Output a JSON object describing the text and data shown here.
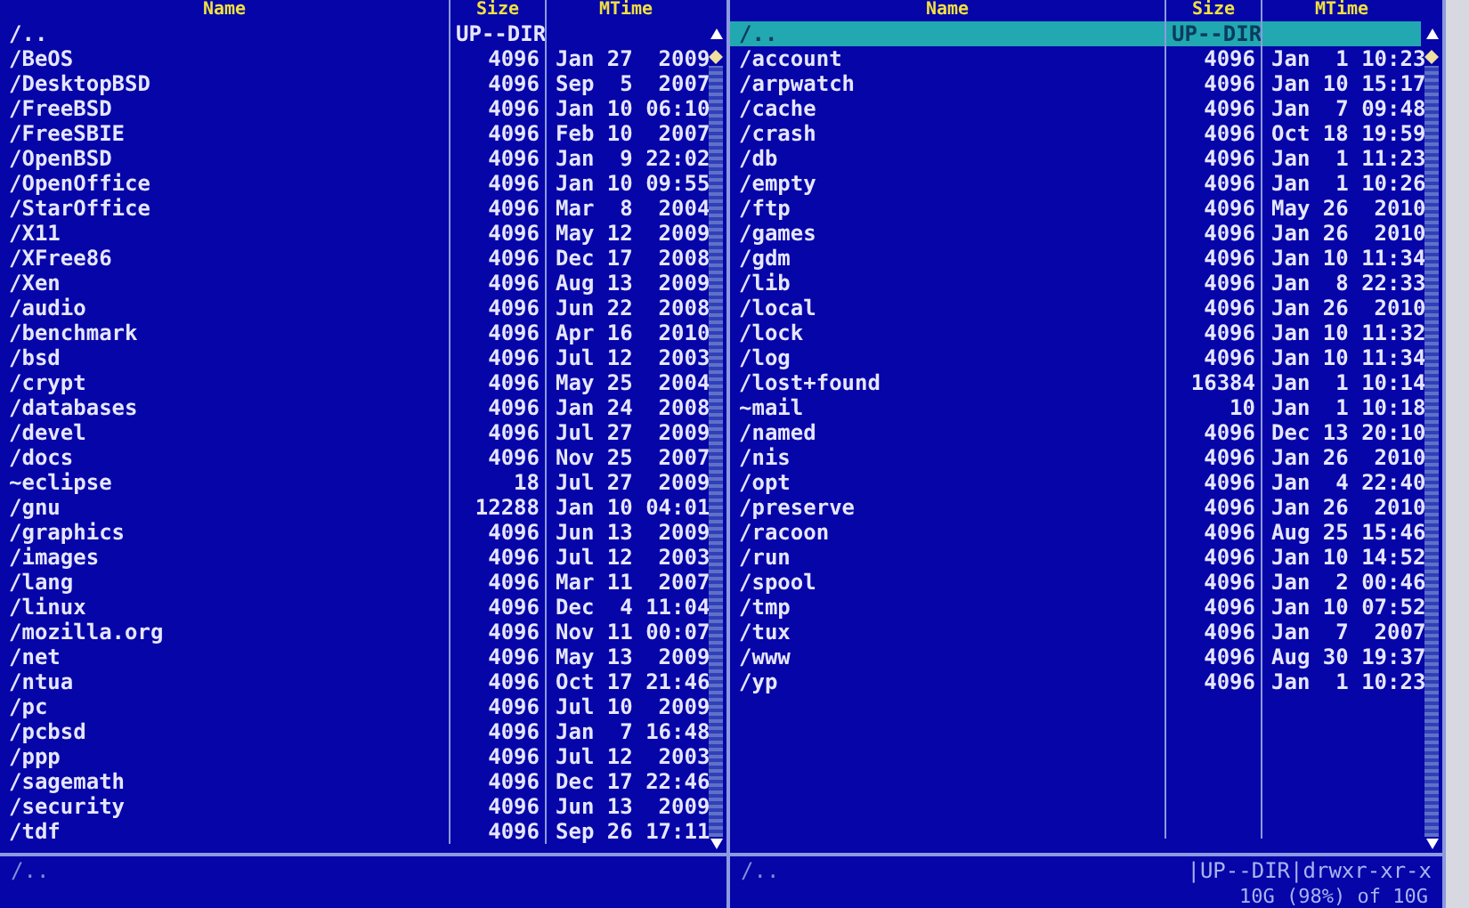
{
  "panels": [
    {
      "columns": [
        "Name",
        "Size",
        "MTime"
      ],
      "rows": [
        {
          "name": "/..",
          "size": "UP--DIR",
          "selected": false
        },
        {
          "name": "/BeOS",
          "size": "4096",
          "mtime": "Jan 27  2009",
          "selected": false
        },
        {
          "name": "/DesktopBSD",
          "size": "4096",
          "mtime": "Sep  5  2007",
          "selected": false
        },
        {
          "name": "/FreeBSD",
          "size": "4096",
          "mtime": "Jan 10 06:10",
          "selected": false
        },
        {
          "name": "/FreeSBIE",
          "size": "4096",
          "mtime": "Feb 10  2007",
          "selected": false
        },
        {
          "name": "/OpenBSD",
          "size": "4096",
          "mtime": "Jan  9 22:02",
          "selected": false
        },
        {
          "name": "/OpenOffice",
          "size": "4096",
          "mtime": "Jan 10 09:55",
          "selected": false
        },
        {
          "name": "/StarOffice",
          "size": "4096",
          "mtime": "Mar  8  2004",
          "selected": false
        },
        {
          "name": "/X11",
          "size": "4096",
          "mtime": "May 12  2009",
          "selected": false
        },
        {
          "name": "/XFree86",
          "size": "4096",
          "mtime": "Dec 17  2008",
          "selected": false
        },
        {
          "name": "/Xen",
          "size": "4096",
          "mtime": "Aug 13  2009",
          "selected": false
        },
        {
          "name": "/audio",
          "size": "4096",
          "mtime": "Jun 22  2008",
          "selected": false
        },
        {
          "name": "/benchmark",
          "size": "4096",
          "mtime": "Apr 16  2010",
          "selected": false
        },
        {
          "name": "/bsd",
          "size": "4096",
          "mtime": "Jul 12  2003",
          "selected": false
        },
        {
          "name": "/crypt",
          "size": "4096",
          "mtime": "May 25  2004",
          "selected": false
        },
        {
          "name": "/databases",
          "size": "4096",
          "mtime": "Jan 24  2008",
          "selected": false
        },
        {
          "name": "/devel",
          "size": "4096",
          "mtime": "Jul 27  2009",
          "selected": false
        },
        {
          "name": "/docs",
          "size": "4096",
          "mtime": "Nov 25  2007",
          "selected": false
        },
        {
          "name": "~eclipse",
          "size": "18",
          "mtime": "Jul 27  2009",
          "selected": false
        },
        {
          "name": "/gnu",
          "size": "12288",
          "mtime": "Jan 10 04:01",
          "selected": false
        },
        {
          "name": "/graphics",
          "size": "4096",
          "mtime": "Jun 13  2009",
          "selected": false
        },
        {
          "name": "/images",
          "size": "4096",
          "mtime": "Jul 12  2003",
          "selected": false
        },
        {
          "name": "/lang",
          "size": "4096",
          "mtime": "Mar 11  2007",
          "selected": false
        },
        {
          "name": "/linux",
          "size": "4096",
          "mtime": "Dec  4 11:04",
          "selected": false
        },
        {
          "name": "/mozilla.org",
          "size": "4096",
          "mtime": "Nov 11 00:07",
          "selected": false
        },
        {
          "name": "/net",
          "size": "4096",
          "mtime": "May 13  2009",
          "selected": false
        },
        {
          "name": "/ntua",
          "size": "4096",
          "mtime": "Oct 17 21:46",
          "selected": false
        },
        {
          "name": "/pc",
          "size": "4096",
          "mtime": "Jul 10  2009",
          "selected": false
        },
        {
          "name": "/pcbsd",
          "size": "4096",
          "mtime": "Jan  7 16:48",
          "selected": false
        },
        {
          "name": "/ppp",
          "size": "4096",
          "mtime": "Jul 12  2003",
          "selected": false
        },
        {
          "name": "/sagemath",
          "size": "4096",
          "mtime": "Dec 17 22:46",
          "selected": false
        },
        {
          "name": "/security",
          "size": "4096",
          "mtime": "Jun 13  2009",
          "selected": false
        },
        {
          "name": "/tdf",
          "size": "4096",
          "mtime": "Sep 26 17:11",
          "selected": false
        }
      ],
      "status": {
        "path": "/.."
      }
    },
    {
      "columns": [
        "Name",
        "Size",
        "MTime"
      ],
      "rows": [
        {
          "name": "/..",
          "size": "UP--DIR",
          "selected": true
        },
        {
          "name": "/account",
          "size": "4096",
          "mtime": "Jan  1 10:23",
          "selected": false
        },
        {
          "name": "/arpwatch",
          "size": "4096",
          "mtime": "Jan 10 15:17",
          "selected": false
        },
        {
          "name": "/cache",
          "size": "4096",
          "mtime": "Jan  7 09:48",
          "selected": false
        },
        {
          "name": "/crash",
          "size": "4096",
          "mtime": "Oct 18 19:59",
          "selected": false
        },
        {
          "name": "/db",
          "size": "4096",
          "mtime": "Jan  1 11:23",
          "selected": false
        },
        {
          "name": "/empty",
          "size": "4096",
          "mtime": "Jan  1 10:26",
          "selected": false
        },
        {
          "name": "/ftp",
          "size": "4096",
          "mtime": "May 26  2010",
          "selected": false
        },
        {
          "name": "/games",
          "size": "4096",
          "mtime": "Jan 26  2010",
          "selected": false
        },
        {
          "name": "/gdm",
          "size": "4096",
          "mtime": "Jan 10 11:34",
          "selected": false
        },
        {
          "name": "/lib",
          "size": "4096",
          "mtime": "Jan  8 22:33",
          "selected": false
        },
        {
          "name": "/local",
          "size": "4096",
          "mtime": "Jan 26  2010",
          "selected": false
        },
        {
          "name": "/lock",
          "size": "4096",
          "mtime": "Jan 10 11:32",
          "selected": false
        },
        {
          "name": "/log",
          "size": "4096",
          "mtime": "Jan 10 11:34",
          "selected": false
        },
        {
          "name": "/lost+found",
          "size": "16384",
          "mtime": "Jan  1 10:14",
          "selected": false
        },
        {
          "name": "~mail",
          "size": "10",
          "mtime": "Jan  1 10:18",
          "selected": false
        },
        {
          "name": "/named",
          "size": "4096",
          "mtime": "Dec 13 20:10",
          "selected": false
        },
        {
          "name": "/nis",
          "size": "4096",
          "mtime": "Jan 26  2010",
          "selected": false
        },
        {
          "name": "/opt",
          "size": "4096",
          "mtime": "Jan  4 22:40",
          "selected": false
        },
        {
          "name": "/preserve",
          "size": "4096",
          "mtime": "Jan 26  2010",
          "selected": false
        },
        {
          "name": "/racoon",
          "size": "4096",
          "mtime": "Aug 25 15:46",
          "selected": false
        },
        {
          "name": "/run",
          "size": "4096",
          "mtime": "Jan 10 14:52",
          "selected": false
        },
        {
          "name": "/spool",
          "size": "4096",
          "mtime": "Jan  2 00:46",
          "selected": false
        },
        {
          "name": "/tmp",
          "size": "4096",
          "mtime": "Jan 10 07:52",
          "selected": false
        },
        {
          "name": "/tux",
          "size": "4096",
          "mtime": "Jan  7  2007",
          "selected": false
        },
        {
          "name": "/www",
          "size": "4096",
          "mtime": "Aug 30 19:37",
          "selected": false
        },
        {
          "name": "/yp",
          "size": "4096",
          "mtime": "Jan  1 10:23",
          "selected": false
        }
      ],
      "status": {
        "path": "/..",
        "info": "|UP--DIR|drwxr-xr-x",
        "free_space": "10G (98%) of 10G"
      }
    }
  ]
}
